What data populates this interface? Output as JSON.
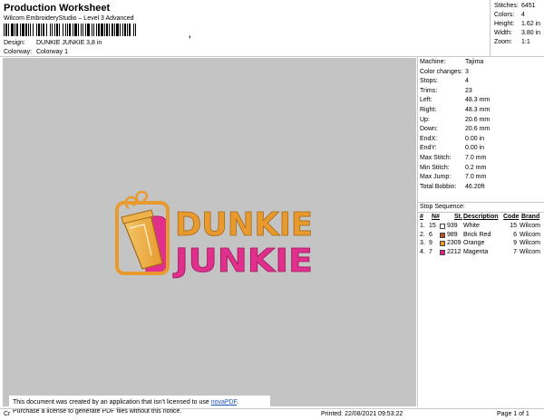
{
  "header": {
    "title": "Production Worksheet",
    "subtitle": "Wilcom EmbroideryStudio – Level 3 Advanced",
    "barcode_suffix": ",",
    "design_label": "Design:",
    "design_value": "DUNKIE JUNKIE 3,8 in",
    "colorway_label": "Colorway:",
    "colorway_value": "Colorway 1"
  },
  "stats": {
    "stitches_label": "Stitches:",
    "stitches_value": "6451",
    "colors_label": "Colors:",
    "colors_value": "4",
    "height_label": "Height:",
    "height_value": "1.62 in",
    "width_label": "Width:",
    "width_value": "3.80 in",
    "zoom_label": "Zoom:",
    "zoom_value": "1:1"
  },
  "design_logo": {
    "line1": "DUNKIE",
    "line2": "JUNKIE",
    "orange": "#e89a2e",
    "pink": "#e0308c"
  },
  "machine": [
    {
      "k": "Machine:",
      "v": "Tajima"
    },
    {
      "k": "Color changes:",
      "v": "3"
    },
    {
      "k": "Stops:",
      "v": "4"
    },
    {
      "k": "Trims:",
      "v": "23"
    },
    {
      "k": "Left:",
      "v": "48.3 mm"
    },
    {
      "k": "Right:",
      "v": "48.3 mm"
    },
    {
      "k": "Up:",
      "v": "20.6 mm"
    },
    {
      "k": "Down:",
      "v": "20.6 mm"
    },
    {
      "k": "EndX:",
      "v": "0.00 in"
    },
    {
      "k": "EndY:",
      "v": "0.00 in"
    },
    {
      "k": "Max Stitch:",
      "v": "7.0 mm"
    },
    {
      "k": "Min Stitch:",
      "v": "0.2 mm"
    },
    {
      "k": "Max Jump:",
      "v": "7.0 mm"
    },
    {
      "k": "Total Bobbin:",
      "v": "46.20ft"
    }
  ],
  "stop_sequence": {
    "label": "Stop Sequence:",
    "headers": {
      "num": "#",
      "n": "N#",
      "st": "St.",
      "desc": "Description",
      "code": "Code",
      "brand": "Brand"
    },
    "rows": [
      {
        "num": "1.",
        "n": "15",
        "color": "#ffffff",
        "st": "939",
        "desc": "White",
        "code": "15",
        "brand": "Wilcom"
      },
      {
        "num": "2.",
        "n": "6",
        "color": "#b5502e",
        "st": "989",
        "desc": "Brick Red",
        "code": "6",
        "brand": "Wilcom"
      },
      {
        "num": "3.",
        "n": "9",
        "color": "#e89a2e",
        "st": "2309",
        "desc": "Orange",
        "code": "9",
        "brand": "Wilcom"
      },
      {
        "num": "4.",
        "n": "7",
        "color": "#e0208c",
        "st": "2212",
        "desc": "Magenta",
        "code": "7",
        "brand": "Wilcom"
      }
    ]
  },
  "notice": {
    "line1_a": "This document was created by an application that isn’t licensed to use ",
    "line1_link": "novaPDF",
    "line1_b": ".",
    "line2": "Purchase a license to generate PDF files without this notice."
  },
  "footer": {
    "cr": "Cr",
    "printed": "Printed: 22/08/2021 09:53:22",
    "page": "Page 1 of 1"
  }
}
